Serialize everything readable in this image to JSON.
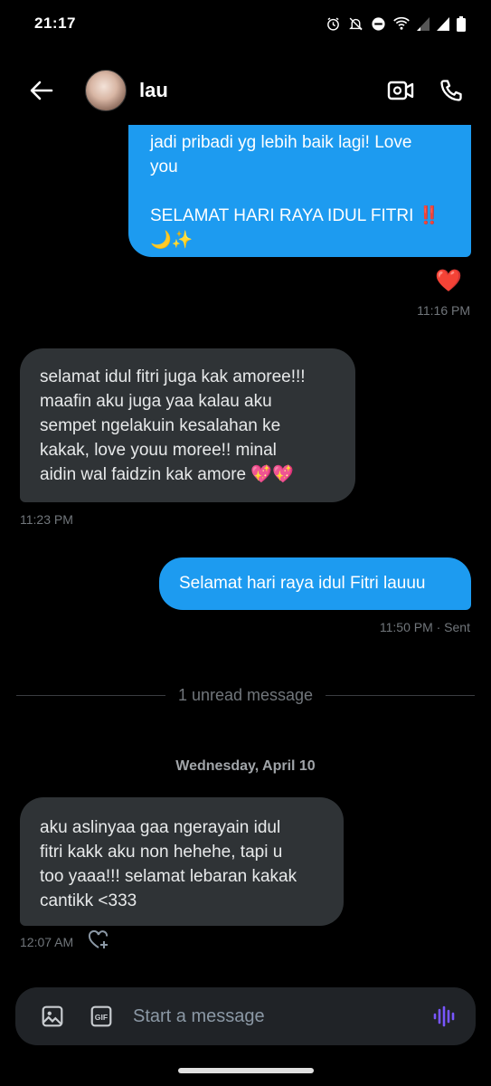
{
  "status_bar": {
    "time": "21:17"
  },
  "header": {
    "contact_name": "lau"
  },
  "messages": [
    {
      "direction": "sent",
      "lines": [
        "jadi pribadi yg lebih baik lagi! Love",
        "you",
        "",
        "SELAMAT HARI RAYA IDUL FITRI ‼️",
        "🌙✨"
      ],
      "reaction": "❤️",
      "time": "11:16 PM"
    },
    {
      "direction": "received",
      "lines": [
        "selamat idul fitri juga kak amoree!!!",
        "maafin aku juga yaa kalau aku",
        "sempet ngelakuin kesalahan ke",
        "kakak, love youu moree!! minal",
        "aidin wal faidzin kak amore 💖💖"
      ],
      "time": "11:23 PM"
    },
    {
      "direction": "sent",
      "lines": [
        "Selamat hari raya idul Fitri lauuu"
      ],
      "time": "11:50 PM · Sent"
    },
    {
      "direction": "received",
      "lines": [
        "aku aslinyaa gaa ngerayain idul",
        "fitri kakk aku non hehehe, tapi u",
        "too yaaa!!! selamat lebaran kakak",
        "cantikk <333"
      ],
      "time": "12:07 AM"
    }
  ],
  "unread_divider": "1 unread message",
  "date_separator": "Wednesday, April 10",
  "composer": {
    "placeholder": "Start a message"
  },
  "colors": {
    "sent_bubble": "#1d9bf0",
    "received_bubble": "#2f3336",
    "background": "#000000",
    "voice_accent": "#7856ff"
  }
}
